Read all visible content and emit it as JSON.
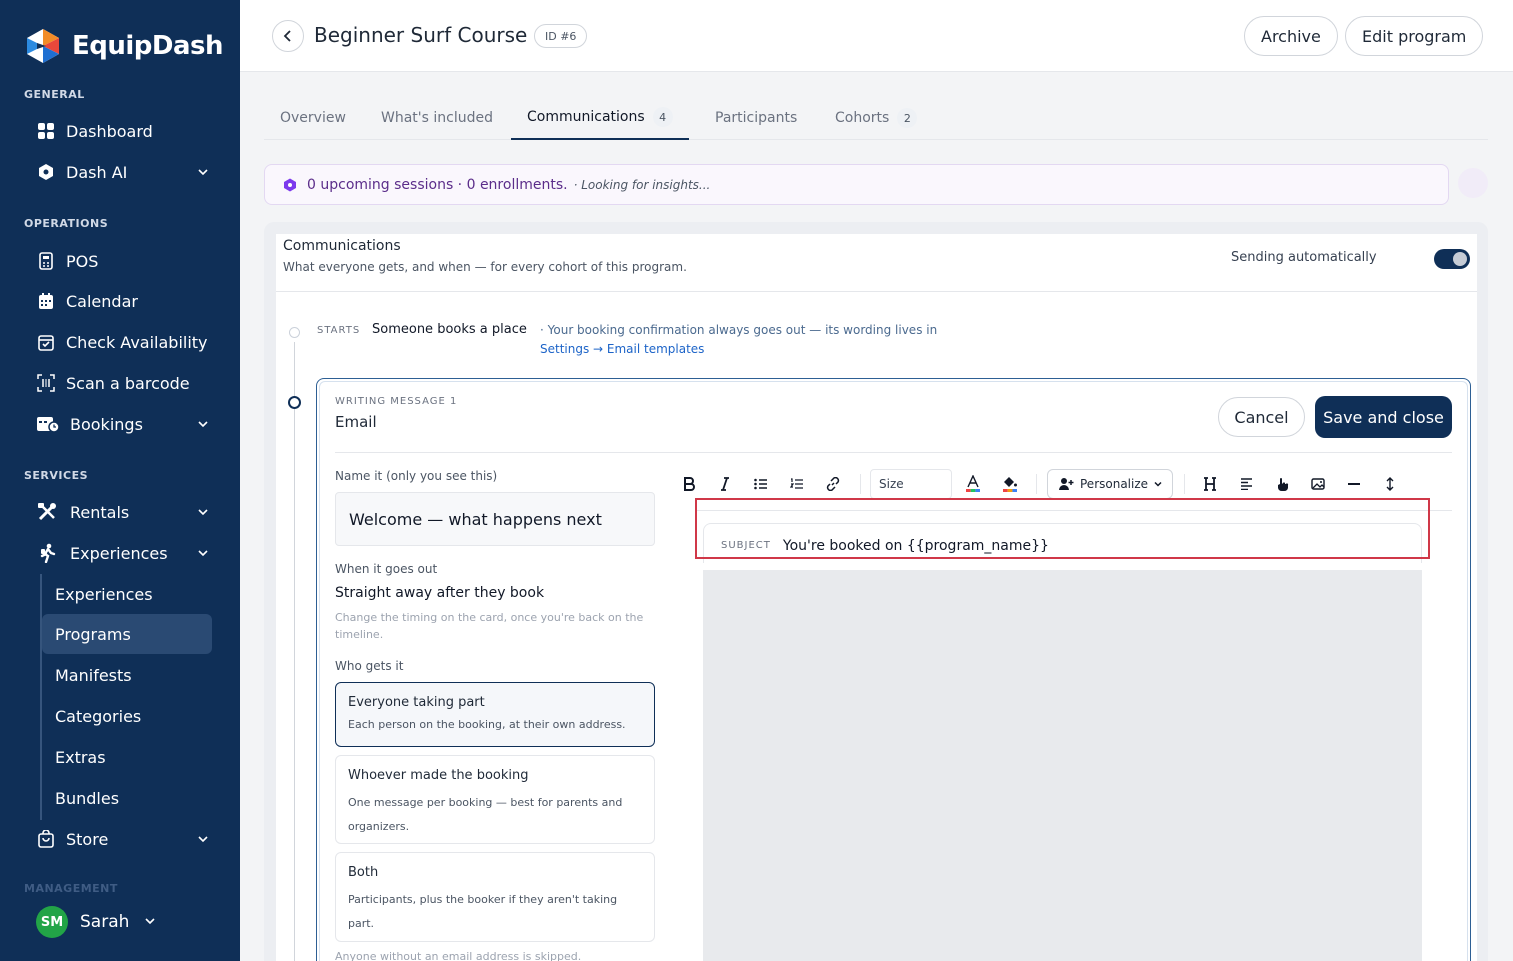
{
  "app": {
    "name": "EquipDash"
  },
  "sidebar": {
    "sections": [
      {
        "label": "GENERAL"
      },
      {
        "label": "OPERATIONS"
      },
      {
        "label": "SERVICES"
      },
      {
        "label": "MANAGEMENT"
      }
    ],
    "items": {
      "dashboard": "Dashboard",
      "dash_ai": "Dash AI",
      "pos": "POS",
      "calendar": "Calendar",
      "check_availability": "Check Availability",
      "scan_barcode": "Scan a barcode",
      "bookings": "Bookings",
      "rentals": "Rentals",
      "experiences": "Experiences",
      "store": "Store"
    },
    "sub_items": [
      "Experiences",
      "Programs",
      "Manifests",
      "Categories",
      "Extras",
      "Bundles"
    ],
    "active_sub_item": "Programs",
    "user": {
      "initials": "SM",
      "name": "Sarah"
    }
  },
  "header": {
    "title": "Beginner Surf Course",
    "id_badge": "ID #6",
    "archive_label": "Archive",
    "edit_label": "Edit program"
  },
  "tabs": [
    {
      "label": "Overview"
    },
    {
      "label": "What's included"
    },
    {
      "label": "Communications",
      "count": "4",
      "active": true
    },
    {
      "label": "Participants"
    },
    {
      "label": "Cohorts",
      "count": "2"
    }
  ],
  "insight": {
    "summary": "0 upcoming sessions · 0 enrollments.",
    "status": "· Looking for insights..."
  },
  "communications": {
    "title": "Communications",
    "subtitle": "What everyone gets, and when — for every cohort of this program.",
    "auto_label": "Sending automatically",
    "auto_enabled": true,
    "starts": {
      "label": "STARTS",
      "title": "Someone books a place",
      "note": "· Your booking confirmation always goes out — its wording lives in",
      "link": "Settings → Email templates"
    }
  },
  "editor": {
    "writing_label": "WRITING MESSAGE 1",
    "type": "Email",
    "cancel_label": "Cancel",
    "save_label": "Save and close",
    "name_label": "Name it (only you see this)",
    "name_value": "Welcome — what happens next",
    "when_label": "When it goes out",
    "when_value": "Straight away after they book",
    "when_note": "Change the timing on the card, once you're back on the timeline.",
    "who_label": "Who gets it",
    "recipients": [
      {
        "title": "Everyone taking part",
        "desc": "Each person on the booking, at their own address.",
        "selected": true
      },
      {
        "title": "Whoever made the booking",
        "desc": "One message per booking — best for parents and organizers."
      },
      {
        "title": "Both",
        "desc": "Participants, plus the booker if they aren't taking part."
      }
    ],
    "skip_note": "Anyone without an email address is skipped.",
    "toolbar": {
      "size_label": "Size",
      "personalize_label": "Personalize"
    },
    "subject_label": "SUBJECT",
    "subject_value": "You're booked on {{program_name}}"
  },
  "colors": {
    "sidebar_bg": "#0f2f57",
    "accent": "#0f2f57",
    "highlight": "#d03848",
    "insight_text": "#5b2d8a"
  }
}
